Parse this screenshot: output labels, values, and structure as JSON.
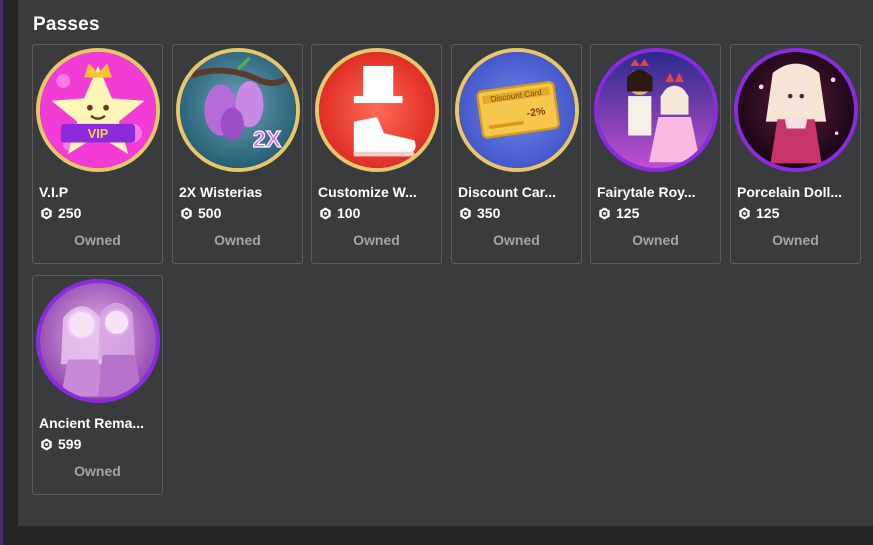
{
  "section": {
    "title": "Passes"
  },
  "passes": [
    {
      "name": "V.I.P",
      "price": "250",
      "status": "Owned",
      "ring_color": "#e8c76a",
      "thumb_icon": "vip-star-crown-icon"
    },
    {
      "name": "2X Wisterias",
      "price": "500",
      "status": "Owned",
      "ring_color": "#e8c76a",
      "thumb_icon": "wisteria-2x-icon"
    },
    {
      "name": "Customize W...",
      "price": "100",
      "status": "Owned",
      "ring_color": "#e8c76a",
      "thumb_icon": "shoe-hat-icon"
    },
    {
      "name": "Discount Car...",
      "price": "350",
      "status": "Owned",
      "ring_color": "#e8c76a",
      "thumb_icon": "discount-card-icon",
      "thumb_text": "Discount Card",
      "thumb_percent": "-2%"
    },
    {
      "name": "Fairytale Roy...",
      "price": "125",
      "status": "Owned",
      "ring_color": "#8a2be2",
      "thumb_icon": "fairytale-royals-icon"
    },
    {
      "name": "Porcelain Doll...",
      "price": "125",
      "status": "Owned",
      "ring_color": "#8a2be2",
      "thumb_icon": "porcelain-doll-icon"
    },
    {
      "name": "Ancient Rema...",
      "price": "599",
      "status": "Owned",
      "ring_color": "#8a2be2",
      "thumb_icon": "ancient-remains-icon"
    }
  ],
  "colors": {
    "panel": "#393b3d",
    "background": "#232527",
    "owned_text": "#a3a5a7"
  }
}
